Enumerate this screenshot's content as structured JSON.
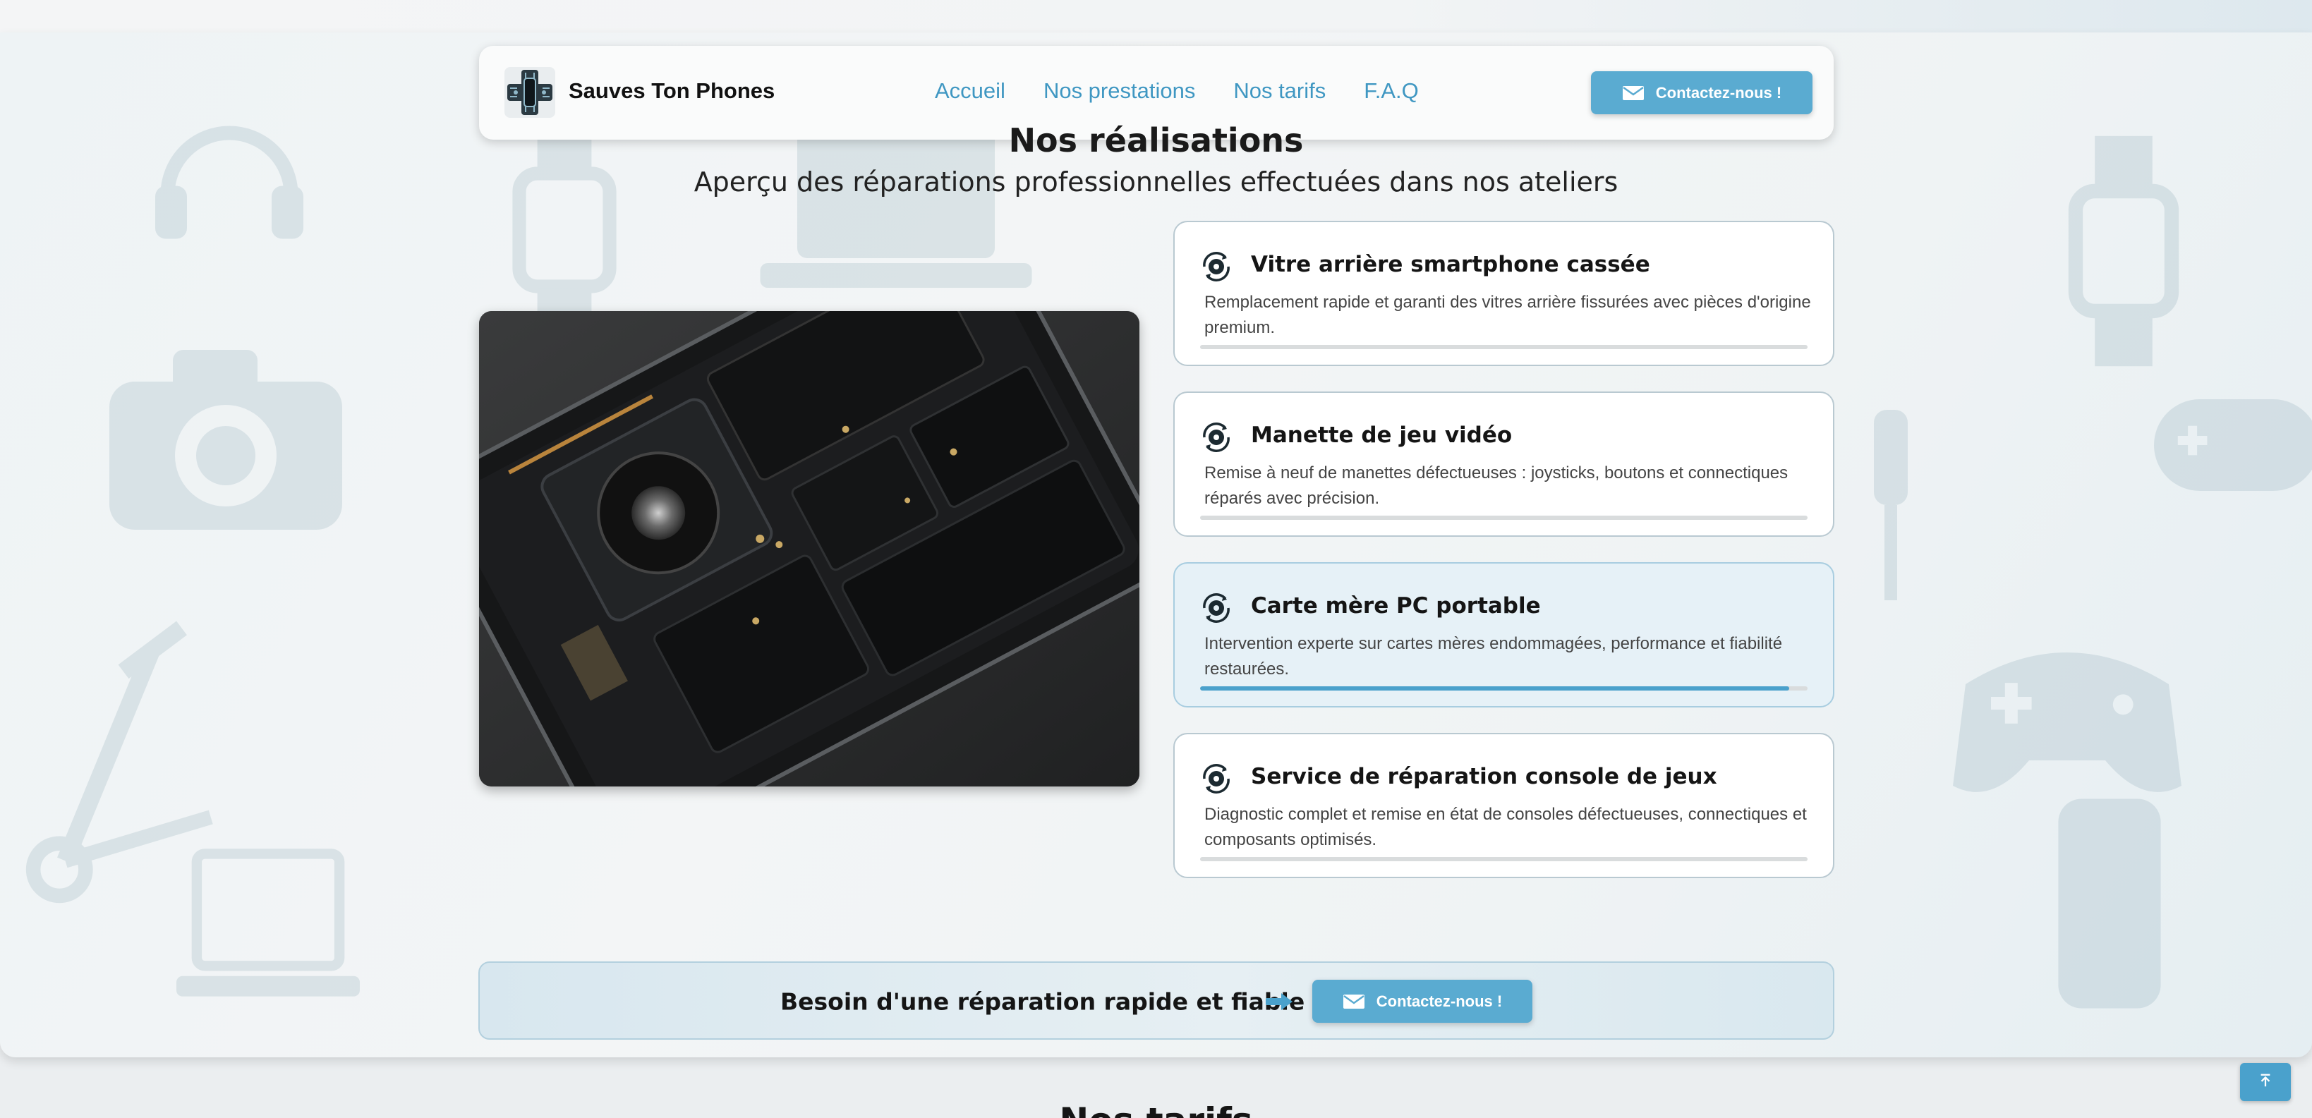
{
  "navbar": {
    "brand": "Sauves Ton Phones",
    "links": [
      "Accueil",
      "Nos prestations",
      "Nos tarifs",
      "F.A.Q"
    ],
    "contact_label": "Contactez-nous !",
    "accent_color": "#5aabd1",
    "link_color": "#3f97c2"
  },
  "section": {
    "title": "Nos réalisations",
    "subtitle": "Aperçu des réparations professionnelles effectuées dans nos ateliers"
  },
  "cards": [
    {
      "title": "Vitre arrière smartphone cassée",
      "description": "Remplacement rapide et garanti des vitres arrière fissurées avec pièces d'origine premium.",
      "progress": 0,
      "active": false,
      "icon": "gear-cycle-icon"
    },
    {
      "title": "Manette de jeu vidéo",
      "description": "Remise à neuf de manettes défectueuses : joysticks, boutons et connectiques réparés avec précision.",
      "progress": 0,
      "active": false,
      "icon": "gear-cycle-icon"
    },
    {
      "title": "Carte mère PC portable",
      "description": "Intervention experte sur cartes mères endommagées, performance et fiabilité restaurées.",
      "progress": 0.97,
      "active": true,
      "icon": "gear-cycle-icon"
    },
    {
      "title": "Service de réparation console de jeux",
      "description": "Diagnostic complet et remise en état de consoles défectueuses, connectiques et composants optimisés.",
      "progress": 0,
      "active": false,
      "icon": "gear-cycle-icon"
    }
  ],
  "cta": {
    "text": "Besoin d'une réparation rapide et fiable ?",
    "button_label": "Contactez-nous !"
  },
  "next_section": {
    "title": "Nos tarifs"
  }
}
